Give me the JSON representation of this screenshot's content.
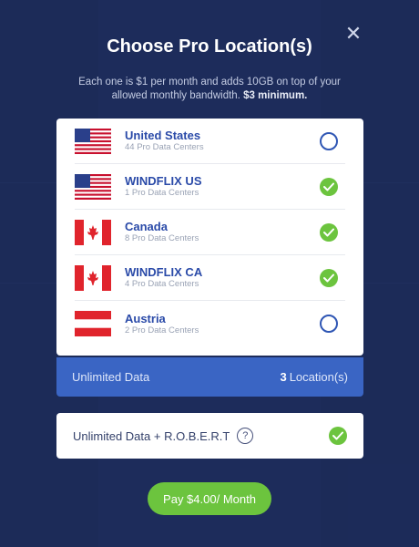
{
  "modal": {
    "title": "Choose Pro Location(s)",
    "subtitle": "Each one is $1 per month and adds 10GB on top of your allowed monthly bandwidth.",
    "subtitle_bold": "$3 minimum.",
    "close_icon": "close-icon"
  },
  "locations": [
    {
      "name": "United States",
      "sub": "44 Pro Data Centers",
      "flag": "us",
      "selected": false
    },
    {
      "name": "WINDFLIX US",
      "sub": "1 Pro Data Centers",
      "flag": "us",
      "selected": true
    },
    {
      "name": "Canada",
      "sub": "8 Pro Data Centers",
      "flag": "ca",
      "selected": true
    },
    {
      "name": "WINDFLIX CA",
      "sub": "4 Pro Data Centers",
      "flag": "ca",
      "selected": true
    },
    {
      "name": "Austria",
      "sub": "2 Pro Data Centers",
      "flag": "at",
      "selected": false
    }
  ],
  "summary": {
    "label": "Unlimited Data",
    "count": "3",
    "count_suffix": "Location(s)"
  },
  "addon": {
    "label": "Unlimited Data + R.O.B.E.R.T",
    "help": "?",
    "selected": true
  },
  "pay_button": "Pay $4.00/ Month",
  "colors": {
    "accent_blue": "#3a65c4",
    "check_green": "#6cc43e",
    "name_blue": "#2a4aa8"
  }
}
